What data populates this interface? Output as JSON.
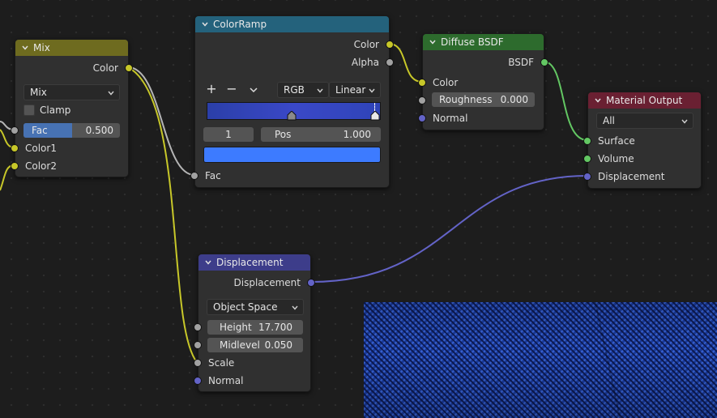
{
  "colors": {
    "mix_header": "#6e6b1f",
    "colorramp_header": "#24627c",
    "diffuse_header": "#2d6b2d",
    "output_header": "#6a2032",
    "displacement_header": "#3d3d8a",
    "socket_color": "#c7c729",
    "socket_float": "#a1a1a1",
    "socket_vector": "#6363c7",
    "socket_shader": "#63c763",
    "ramp_color": "#3d7bff",
    "fac_slider": "#4772b3"
  },
  "mix": {
    "title": "Mix",
    "output_color": "Color",
    "blend_mode": "Mix",
    "clamp_label": "Clamp",
    "clamp_checked": false,
    "fac_label": "Fac",
    "fac_value": "0.500",
    "fac_fraction": 0.5,
    "input_color1": "Color1",
    "input_color2": "Color2"
  },
  "colorramp": {
    "title": "ColorRamp",
    "output_color": "Color",
    "output_alpha": "Alpha",
    "add_symbol": "+",
    "remove_symbol": "−",
    "color_mode": "RGB",
    "interpolation": "Linear",
    "active_index": "1",
    "pos_label": "Pos",
    "pos_value": "1.000",
    "input_fac": "Fac"
  },
  "diffuse": {
    "title": "Diffuse BSDF",
    "output_bsdf": "BSDF",
    "input_color": "Color",
    "roughness_label": "Roughness",
    "roughness_value": "0.000",
    "input_normal": "Normal"
  },
  "output": {
    "title": "Material Output",
    "target": "All",
    "input_surface": "Surface",
    "input_volume": "Volume",
    "input_displacement": "Displacement"
  },
  "displacement": {
    "title": "Displacement",
    "output_displacement": "Displacement",
    "space": "Object Space",
    "height_label": "Height",
    "height_value": "17.700",
    "midlevel_label": "Midlevel",
    "midlevel_value": "0.050",
    "input_scale": "Scale",
    "input_normal": "Normal"
  }
}
